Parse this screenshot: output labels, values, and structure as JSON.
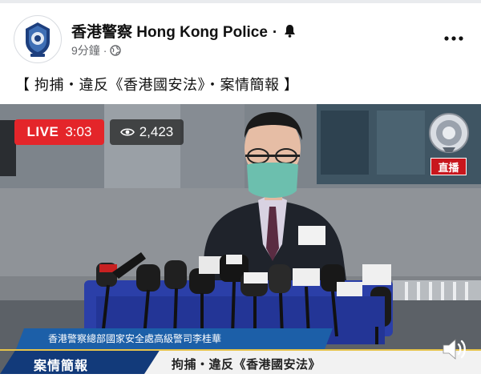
{
  "post": {
    "page_name": "香港警察 Hong Kong Police",
    "separator": "·",
    "time": "9分鐘",
    "meta_separator": "·",
    "caption": "【 拘捕・違反《香港國安法》・案情簡報 】"
  },
  "video": {
    "live_label": "LIVE",
    "duration": "3:03",
    "viewer_count": "2,423",
    "live_tag": "直播",
    "speaker_caption": "香港警察總部國家安全處高級警司李桂華",
    "case_label": "案情簡報",
    "case_topic": "拘捕・違反《香港國安法》"
  },
  "icons": {
    "avatar": "police-badge-icon",
    "bell": "bell-icon",
    "globe": "globe-icon",
    "more": "more-options-icon",
    "eye": "eye-icon",
    "volume": "volume-icon"
  },
  "colors": {
    "live_red": "#e4252a",
    "caption_blue": "#1c5fa8",
    "case_blue": "#123a7a"
  }
}
